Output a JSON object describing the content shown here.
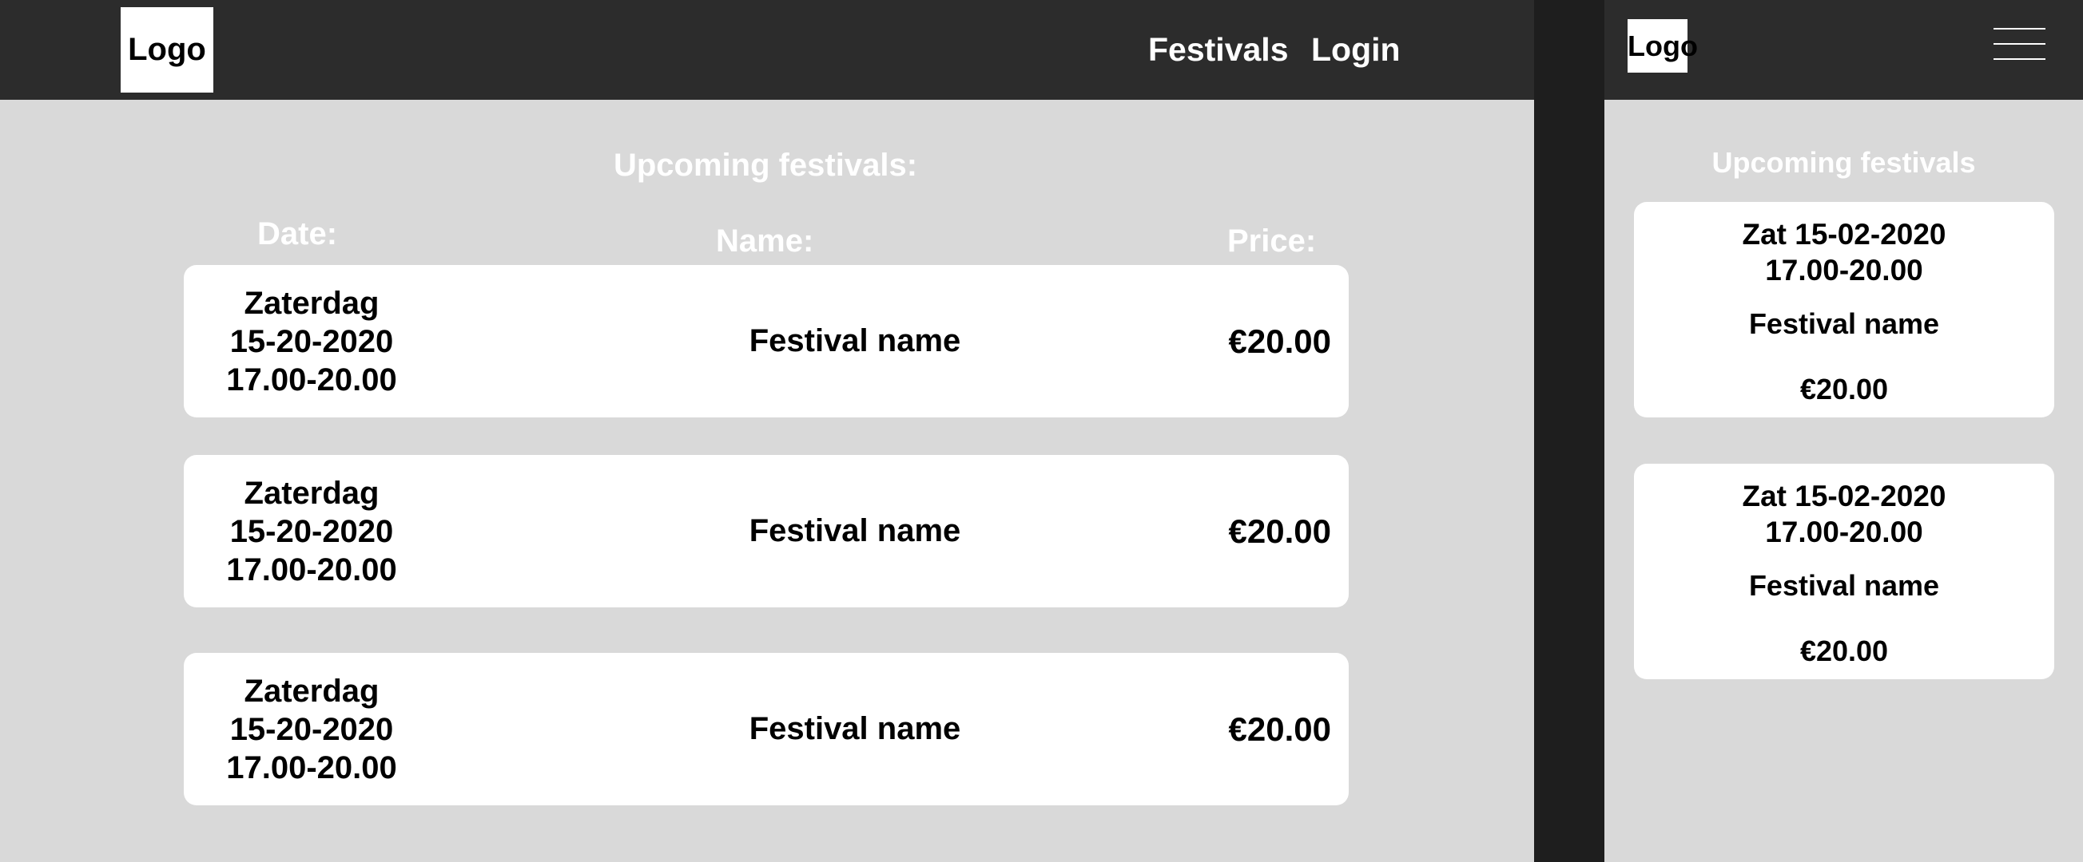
{
  "desktop": {
    "logo": "Logo",
    "nav": {
      "festivals": "Festivals",
      "login": "Login"
    },
    "title": "Upcoming festivals:",
    "headers": {
      "date": "Date:",
      "name": "Name:",
      "price": "Price:"
    },
    "rows": [
      {
        "day": "Zaterdag",
        "date": "15-20-2020",
        "time": "17.00-20.00",
        "name": "Festival name",
        "price": "€20.00"
      },
      {
        "day": "Zaterdag",
        "date": "15-20-2020",
        "time": "17.00-20.00",
        "name": "Festival name",
        "price": "€20.00"
      },
      {
        "day": "Zaterdag",
        "date": "15-20-2020",
        "time": "17.00-20.00",
        "name": "Festival name",
        "price": "€20.00"
      }
    ]
  },
  "mobile": {
    "logo": "Logo",
    "menu_icon": "hamburger-menu-icon",
    "title": "Upcoming festivals",
    "cards": [
      {
        "date": "Zat 15-02-2020",
        "time": "17.00-20.00",
        "name": "Festival name",
        "price": "€20.00"
      },
      {
        "date": "Zat 15-02-2020",
        "time": "17.00-20.00",
        "name": "Festival name",
        "price": "€20.00"
      }
    ]
  },
  "colors": {
    "navbar": "#2c2c2c",
    "page_background": "#d9d9d9",
    "gutter": "#1e1e1e",
    "card": "#ffffff",
    "text_on_dark": "#ffffff"
  }
}
